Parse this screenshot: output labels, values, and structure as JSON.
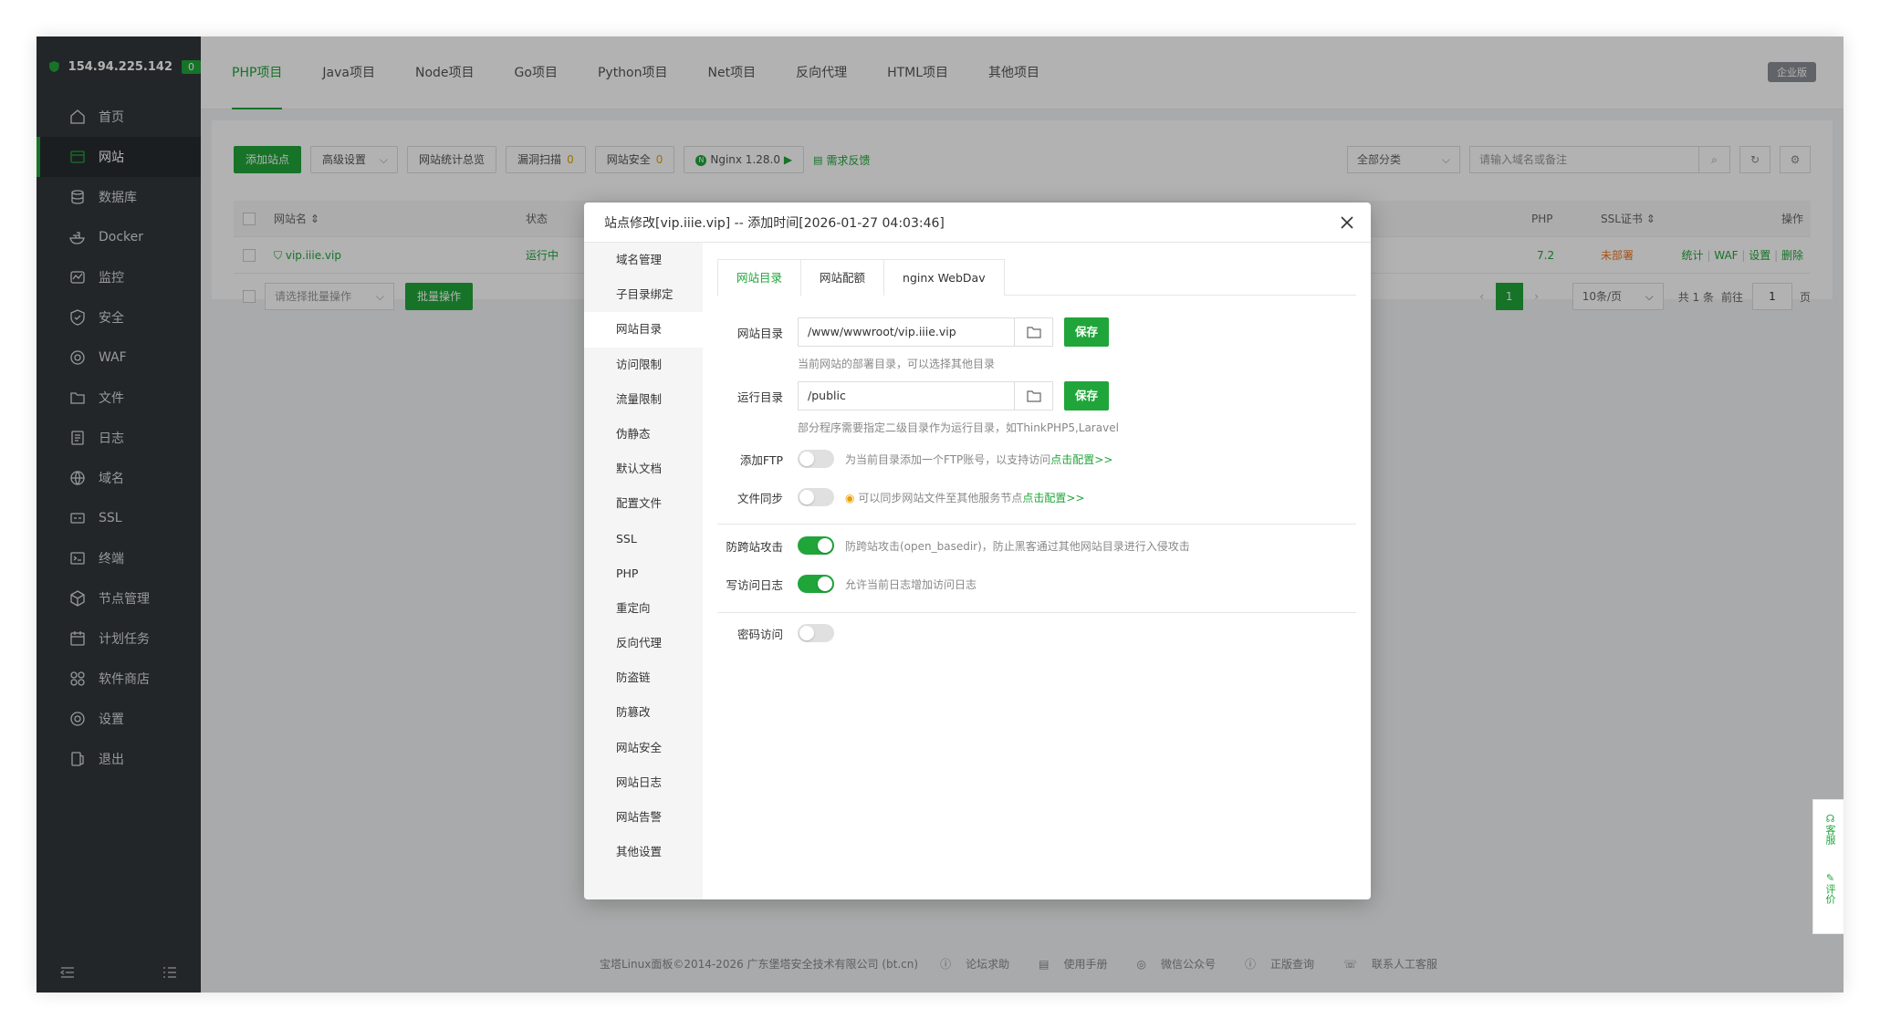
{
  "server": {
    "ip": "154.94.225.142",
    "badge": "0"
  },
  "sidebar": {
    "items": [
      {
        "label": "首页",
        "icon": "home-icon"
      },
      {
        "label": "网站",
        "icon": "website-icon"
      },
      {
        "label": "数据库",
        "icon": "database-icon"
      },
      {
        "label": "Docker",
        "icon": "docker-icon"
      },
      {
        "label": "监控",
        "icon": "monitor-icon"
      },
      {
        "label": "安全",
        "icon": "security-icon"
      },
      {
        "label": "WAF",
        "icon": "waf-icon"
      },
      {
        "label": "文件",
        "icon": "folder-icon"
      },
      {
        "label": "日志",
        "icon": "log-icon"
      },
      {
        "label": "域名",
        "icon": "globe-icon"
      },
      {
        "label": "SSL",
        "icon": "ssl-icon"
      },
      {
        "label": "终端",
        "icon": "terminal-icon"
      },
      {
        "label": "节点管理",
        "icon": "node-icon"
      },
      {
        "label": "计划任务",
        "icon": "calendar-icon"
      },
      {
        "label": "软件商店",
        "icon": "apps-icon"
      },
      {
        "label": "设置",
        "icon": "gear-icon"
      },
      {
        "label": "退出",
        "icon": "logout-icon"
      }
    ]
  },
  "project_tabs": [
    "PHP项目",
    "Java项目",
    "Node项目",
    "Go项目",
    "Python项目",
    "Net项目",
    "反向代理",
    "HTML项目",
    "其他项目"
  ],
  "enterprise_badge": "企业版",
  "toolbar": {
    "add_site": "添加站点",
    "advanced": "高级设置",
    "stats": "网站统计总览",
    "vuln_scan": "漏洞扫描",
    "vuln_count": "0",
    "site_security": "网站安全",
    "security_count": "0",
    "nginx": "Nginx 1.28.0",
    "feedback": "需求反馈",
    "category": "全部分类",
    "search_placeholder": "请输入域名或备注"
  },
  "table": {
    "headers": {
      "name": "网站名",
      "status": "状态",
      "php": "PHP",
      "ssl": "SSL证书",
      "ops": "操作"
    },
    "row": {
      "name": "vip.iiie.vip",
      "status": "运行中",
      "php": "7.2",
      "ssl": "未部署",
      "ops": [
        "统计",
        "WAF",
        "设置",
        "删除"
      ]
    },
    "batch_placeholder": "请选择批量操作",
    "batch_button": "批量操作"
  },
  "pager": {
    "page": "1",
    "per_page": "10条/页",
    "total": "共 1 条",
    "goto": "前往",
    "goto_value": "1",
    "unit": "页"
  },
  "footer": {
    "copyright": "宝塔Linux面板©2014-2026 广东堡塔安全技术有限公司 (bt.cn)",
    "links": [
      "论坛求助",
      "使用手册",
      "微信公众号",
      "正版查询",
      "联系人工客服"
    ]
  },
  "side_widget": {
    "service": "客服",
    "review": "评价"
  },
  "modal": {
    "title": "站点修改[vip.iiie.vip] -- 添加时间[2026-01-27 04:03:46]",
    "menu": [
      "域名管理",
      "子目录绑定",
      "网站目录",
      "访问限制",
      "流量限制",
      "伪静态",
      "默认文档",
      "配置文件",
      "SSL",
      "PHP",
      "重定向",
      "反向代理",
      "防盗链",
      "防篡改",
      "网站安全",
      "网站日志",
      "网站告警",
      "其他设置"
    ],
    "active_menu": "网站目录",
    "tabs": [
      "网站目录",
      "网站配额",
      "nginx WebDav"
    ],
    "site_dir": {
      "label": "网站目录",
      "value": "/www/wwwroot/vip.iiie.vip",
      "save": "保存",
      "hint": "当前网站的部署目录，可以选择其他目录"
    },
    "run_dir": {
      "label": "运行目录",
      "value": "/public",
      "save": "保存",
      "hint": "部分程序需要指定二级目录作为运行目录，如ThinkPHP5,Laravel"
    },
    "ftp": {
      "label": "添加FTP",
      "on": false,
      "desc": "为当前目录添加一个FTP账号，以支持访问",
      "link": "点击配置>>"
    },
    "sync": {
      "label": "文件同步",
      "on": false,
      "desc": "可以同步网站文件至其他服务节点",
      "link": "点击配置>>"
    },
    "cross_site": {
      "label": "防跨站攻击",
      "on": true,
      "desc": "防跨站攻击(open_basedir)，防止黑客通过其他网站目录进行入侵攻击"
    },
    "access_log": {
      "label": "写访问日志",
      "on": true,
      "desc": "允许当前日志增加访问日志"
    },
    "password": {
      "label": "密码访问",
      "on": false
    }
  },
  "colors": {
    "accent": "#20a53a",
    "sidebar_bg": "#32373b",
    "warning": "#f0761f"
  }
}
